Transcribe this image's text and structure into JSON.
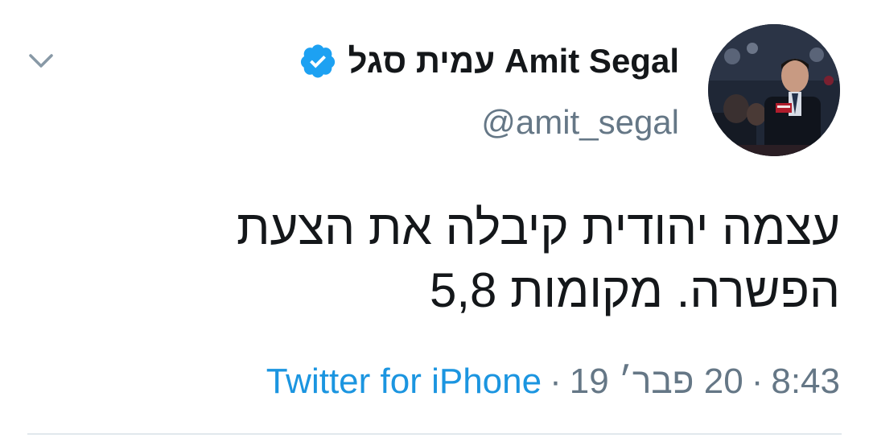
{
  "tweet": {
    "author": {
      "display_name": "עמית סגל Amit Segal",
      "handle": "@amit_segal",
      "verified": true,
      "verified_icon": "verified-badge-icon",
      "avatar": "profile-photo"
    },
    "text": "עצמה יהודית קיבלה את הצעת הפשרה. מקומות 5,8",
    "time": "8:43",
    "date": "20 פבר׳ 19",
    "source": "Twitter for iPhone",
    "separator": "·"
  },
  "menu_icon": "chevron-down-icon",
  "colors": {
    "text": "#14171a",
    "secondary": "#657786",
    "link": "#1b95e0",
    "verified": "#1da1f2",
    "divider": "#e1e8ed"
  }
}
